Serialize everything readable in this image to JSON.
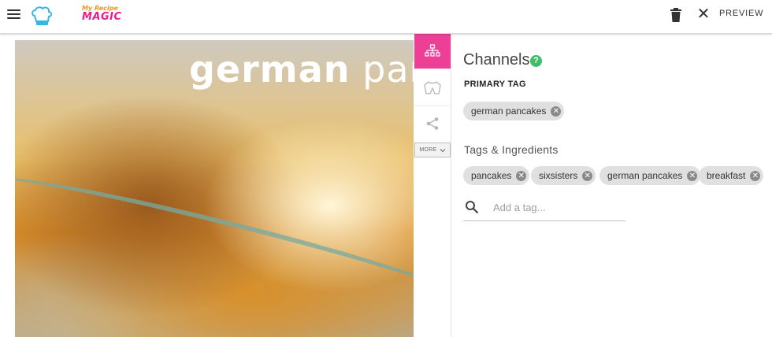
{
  "header": {
    "logo_top": "My Recipe",
    "logo_bottom": "MAGIC",
    "preview_label": "PREVIEW"
  },
  "photo": {
    "overlay_text_bold": "german",
    "overlay_text_light": " panc"
  },
  "sidebar": {
    "more_label": "MORE"
  },
  "panel": {
    "title": "Channels",
    "help_glyph": "?",
    "primary_tag_label": "PRIMARY TAG",
    "primary_tag": "german pancakes",
    "tags_label": "Tags & Ingredients",
    "tags": [
      "pancakes",
      "sixsisters",
      "german pancakes",
      "breakfast"
    ],
    "add_tag_placeholder": "Add a tag..."
  },
  "colors": {
    "accent_pink": "#ee3f97",
    "help_green": "#3dbf6a",
    "chip_bg": "#e0e0e0"
  },
  "icons": [
    "menu-icon",
    "logo-chef-hat-icon",
    "trash-icon",
    "close-icon",
    "sitemap-icon",
    "tshirt-icon",
    "share-icon",
    "chevron-down-icon",
    "help-icon",
    "chip-remove-icon",
    "search-icon"
  ]
}
